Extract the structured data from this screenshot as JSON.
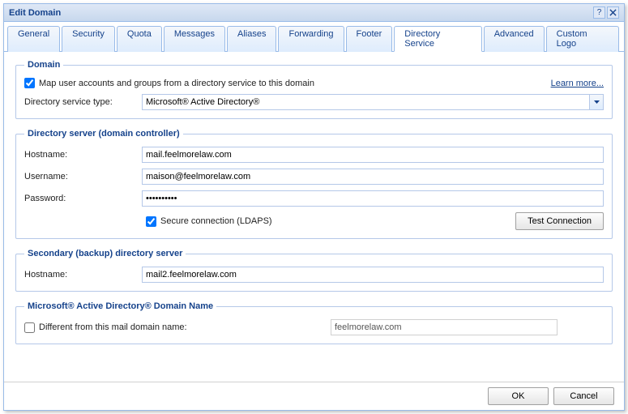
{
  "dialog": {
    "title": "Edit Domain"
  },
  "tabs": {
    "general": "General",
    "security": "Security",
    "quota": "Quota",
    "messages": "Messages",
    "aliases": "Aliases",
    "forwarding": "Forwarding",
    "footer": "Footer",
    "directory_service": "Directory Service",
    "advanced": "Advanced",
    "custom_logo": "Custom Logo"
  },
  "domain": {
    "legend": "Domain",
    "map_label": "Map user accounts and groups from a directory service to this domain",
    "learn_more": "Learn more...",
    "dir_type_label": "Directory service type:",
    "dir_type_value": "Microsoft® Active Directory®"
  },
  "dirserver": {
    "legend": "Directory server (domain controller)",
    "hostname_label": "Hostname:",
    "hostname_value": "mail.feelmorelaw.com",
    "username_label": "Username:",
    "username_value": "maison@feelmorelaw.com",
    "password_label": "Password:",
    "password_value": "••••••••••",
    "secure_label": "Secure connection (LDAPS)",
    "test_btn": "Test Connection"
  },
  "secondary": {
    "legend": "Secondary (backup) directory server",
    "hostname_label": "Hostname:",
    "hostname_value": "mail2.feelmorelaw.com"
  },
  "adname": {
    "legend": "Microsoft® Active Directory® Domain Name",
    "diff_label": "Different from this mail domain name:",
    "domain_value": "feelmorelaw.com"
  },
  "buttons": {
    "ok": "OK",
    "cancel": "Cancel"
  }
}
